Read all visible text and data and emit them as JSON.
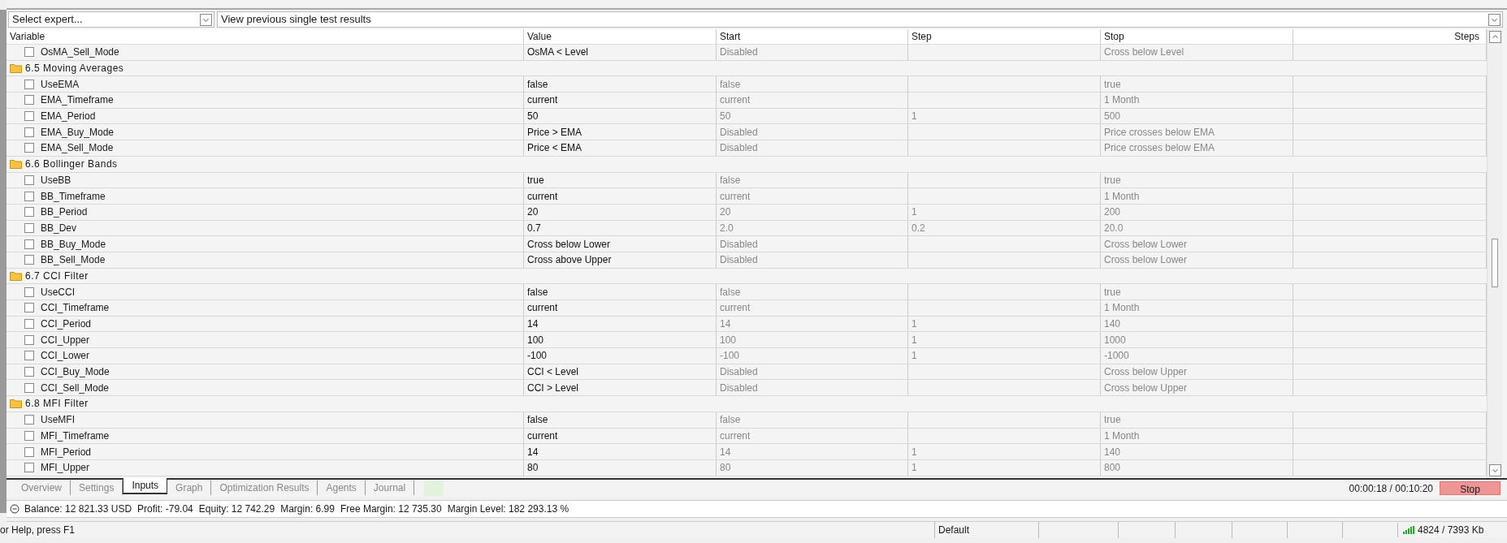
{
  "toolbar": {
    "expert_select": "Select expert...",
    "results_select": "View previous single test results"
  },
  "table": {
    "columns": [
      "Variable",
      "Value",
      "Start",
      "Step",
      "Stop",
      "Steps"
    ],
    "rows": [
      {
        "kind": "param",
        "name": "OsMA_Sell_Mode",
        "checked": false,
        "value": "OsMA < Level",
        "start": "Disabled",
        "stop": "Cross below Level"
      },
      {
        "kind": "group",
        "name": "6.5 Moving Averages"
      },
      {
        "kind": "param",
        "name": "UseEMA",
        "checked": false,
        "value": "false",
        "start": "false",
        "stop": "true"
      },
      {
        "kind": "param",
        "name": "EMA_Timeframe",
        "checked": false,
        "value": "current",
        "start": "current",
        "stop": "1 Month"
      },
      {
        "kind": "param",
        "name": "EMA_Period",
        "checked": false,
        "value": "50",
        "start": "50",
        "step": "1",
        "stop": "500"
      },
      {
        "kind": "param",
        "name": "EMA_Buy_Mode",
        "checked": false,
        "value": "Price > EMA",
        "start": "Disabled",
        "stop": "Price crosses below EMA"
      },
      {
        "kind": "param",
        "name": "EMA_Sell_Mode",
        "checked": false,
        "value": "Price < EMA",
        "start": "Disabled",
        "stop": "Price crosses below EMA"
      },
      {
        "kind": "group",
        "name": "6.6 Bollinger Bands"
      },
      {
        "kind": "param",
        "name": "UseBB",
        "checked": false,
        "value": "true",
        "start": "false",
        "stop": "true"
      },
      {
        "kind": "param",
        "name": "BB_Timeframe",
        "checked": false,
        "value": "current",
        "start": "current",
        "stop": "1 Month"
      },
      {
        "kind": "param",
        "name": "BB_Period",
        "checked": false,
        "value": "20",
        "start": "20",
        "step": "1",
        "stop": "200"
      },
      {
        "kind": "param",
        "name": "BB_Dev",
        "checked": false,
        "value": "0.7",
        "start": "2.0",
        "step": "0.2",
        "stop": "20.0"
      },
      {
        "kind": "param",
        "name": "BB_Buy_Mode",
        "checked": false,
        "value": "Cross below Lower",
        "start": "Disabled",
        "stop": "Cross below Lower"
      },
      {
        "kind": "param",
        "name": "BB_Sell_Mode",
        "checked": false,
        "value": "Cross above Upper",
        "start": "Disabled",
        "stop": "Cross below Lower"
      },
      {
        "kind": "group",
        "name": "6.7 CCI Filter"
      },
      {
        "kind": "param",
        "name": "UseCCI",
        "checked": false,
        "value": "false",
        "start": "false",
        "stop": "true"
      },
      {
        "kind": "param",
        "name": "CCI_Timeframe",
        "checked": false,
        "value": "current",
        "start": "current",
        "stop": "1 Month"
      },
      {
        "kind": "param",
        "name": "CCI_Period",
        "checked": false,
        "value": "14",
        "start": "14",
        "step": "1",
        "stop": "140"
      },
      {
        "kind": "param",
        "name": "CCI_Upper",
        "checked": false,
        "value": "100",
        "start": "100",
        "step": "1",
        "stop": "1000"
      },
      {
        "kind": "param",
        "name": "CCI_Lower",
        "checked": false,
        "value": "-100",
        "start": "-100",
        "step": "1",
        "stop": "-1000"
      },
      {
        "kind": "param",
        "name": "CCI_Buy_Mode",
        "checked": false,
        "value": "CCI < Level",
        "start": "Disabled",
        "stop": "Cross below Upper"
      },
      {
        "kind": "param",
        "name": "CCI_Sell_Mode",
        "checked": false,
        "value": "CCI > Level",
        "start": "Disabled",
        "stop": "Cross below Upper"
      },
      {
        "kind": "group",
        "name": "6.8 MFI Filter"
      },
      {
        "kind": "param",
        "name": "UseMFI",
        "checked": false,
        "value": "false",
        "start": "false",
        "stop": "true"
      },
      {
        "kind": "param",
        "name": "MFI_Timeframe",
        "checked": false,
        "value": "current",
        "start": "current",
        "stop": "1 Month"
      },
      {
        "kind": "param",
        "name": "MFI_Period",
        "checked": false,
        "value": "14",
        "start": "14",
        "step": "1",
        "stop": "140"
      },
      {
        "kind": "param",
        "name": "MFI_Upper",
        "checked": false,
        "value": "80",
        "start": "80",
        "step": "1",
        "stop": "800"
      }
    ]
  },
  "tabs": [
    {
      "label": "Overview",
      "selected": false
    },
    {
      "label": "Settings",
      "selected": false
    },
    {
      "label": "Inputs",
      "selected": true
    },
    {
      "label": "Graph",
      "selected": false
    },
    {
      "label": "Optimization Results",
      "selected": false
    },
    {
      "label": "Agents",
      "selected": false
    },
    {
      "label": "Journal",
      "selected": false
    }
  ],
  "timer": "00:00:18 / 00:10:20",
  "stop_button": "Stop",
  "account": [
    "Balance: 12 821.33 USD",
    "Profit: -79.04",
    "Equity: 12 742.29",
    "Margin: 6.99",
    "Free Margin: 12 735.30",
    "Margin Level: 182 293.13 %"
  ],
  "status_bar": {
    "help": "or Help, press F1",
    "profile": "Default",
    "memory": "4824 / 7393 Kb"
  }
}
